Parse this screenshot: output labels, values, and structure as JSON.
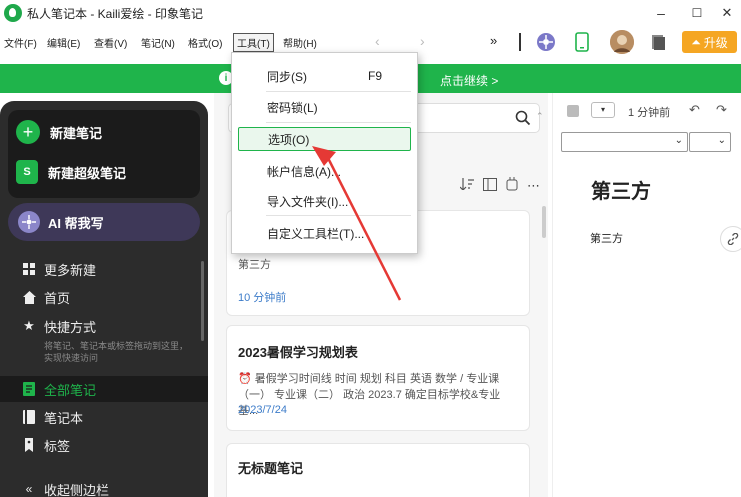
{
  "window": {
    "title": "私人笔记本 - Kaili爱绘 - 印象笔记",
    "min_glyph": "–",
    "max_glyph": "☐",
    "close_glyph": "✕"
  },
  "menubar": {
    "items": [
      "文件(F)",
      "编辑(E)",
      "查看(V)",
      "笔记(N)",
      "格式(O)",
      "工具(T)",
      "帮助(H)"
    ],
    "more": "»",
    "upgrade_label": "升级"
  },
  "banner": {
    "info_glyph": "i",
    "text": "点击继续 >"
  },
  "sidebar": {
    "new_note": "新建笔记",
    "new_super_note": "新建超级笔记",
    "super_icon_text": "S",
    "ai_write": "AI 帮我写",
    "items": [
      {
        "label": "更多新建",
        "icon": "grid-icon"
      },
      {
        "label": "首页",
        "icon": "home-icon"
      },
      {
        "label": "快捷方式",
        "icon": "star-icon"
      },
      {
        "label": "全部笔记",
        "icon": "notes-icon"
      },
      {
        "label": "笔记本",
        "icon": "notebook-icon"
      },
      {
        "label": "标签",
        "icon": "tag-icon"
      }
    ],
    "shortcut_hint": "将笔记、笔记本或标签拖动到这里，实现快速访问",
    "collapse": "收起侧边栏"
  },
  "notes": [
    {
      "title": "",
      "snippet": "第三方",
      "date": "10 分钟前"
    },
    {
      "title": "2023暑假学习规划表",
      "snippet": "⏰ 暑假学习时间线 时间 规划 科目 英语 数学 / 专业课（一） 专业课（二） 政治 2023.7 确定目标学校&专业 基...",
      "date": "2023/7/24"
    },
    {
      "title": "无标题笔记",
      "snippet": "",
      "date": ""
    }
  ],
  "editor": {
    "timestamp": "1 分钟前",
    "title": "第三方",
    "body": "第三方"
  },
  "tools_menu": {
    "items": [
      {
        "label": "同步(S)",
        "shortcut": "F9"
      },
      {
        "label": "密码锁(L)",
        "shortcut": ""
      },
      {
        "label": "选项(O)",
        "shortcut": ""
      },
      {
        "label": "帐户信息(A)...",
        "shortcut": ""
      },
      {
        "label": "导入文件夹(I)...",
        "shortcut": ""
      },
      {
        "label": "自定义工具栏(T)...",
        "shortcut": ""
      }
    ],
    "highlighted_index": 2
  },
  "colors": {
    "brand_green": "#1fb44b",
    "upgrade_orange": "#f5a623",
    "annotation_red": "#e53935"
  }
}
